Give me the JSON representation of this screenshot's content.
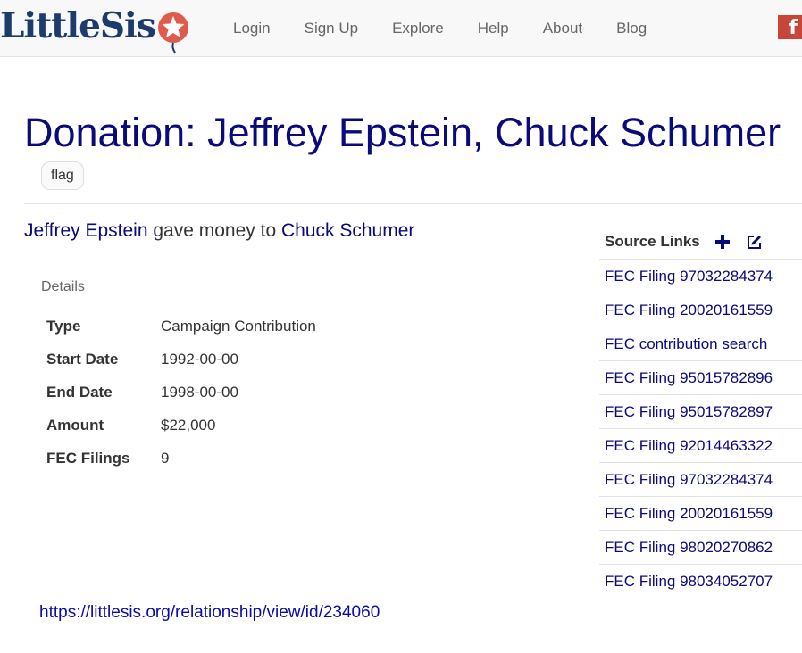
{
  "navbar": {
    "logo_text": "LittleSis",
    "links": [
      "Login",
      "Sign Up",
      "Explore",
      "Help",
      "About",
      "Blog"
    ],
    "facebook_glyph": "f",
    "brand_color": "#1d3c6b",
    "accent_color": "#e05a4d"
  },
  "page": {
    "title": "Donation: Jeffrey Epstein, Chuck Schumer",
    "flag_label": "flag",
    "description": {
      "entity1": "Jeffrey Epstein",
      "verb": "gave money to",
      "entity2": "Chuck Schumer"
    }
  },
  "details": {
    "heading": "Details",
    "rows": [
      {
        "key": "Type",
        "value": "Campaign Contribution"
      },
      {
        "key": "Start Date",
        "value": "1992-00-00"
      },
      {
        "key": "End Date",
        "value": "1998-00-00"
      },
      {
        "key": "Amount",
        "value": "$22,000"
      },
      {
        "key": "FEC Filings",
        "value": "9"
      }
    ]
  },
  "source_links": {
    "title": "Source Links",
    "add_icon": "plus-icon",
    "edit_icon": "edit-icon",
    "items": [
      "FEC Filing 97032284374",
      "FEC Filing 20020161559",
      "FEC contribution search",
      "FEC Filing 95015782896",
      "FEC Filing 95015782897",
      "FEC Filing 92014463322",
      "FEC Filing 97032284374",
      "FEC Filing 20020161559",
      "FEC Filing 98020270862",
      "FEC Filing 98034052707"
    ]
  },
  "footer": {
    "url": "https://littlesis.org/relationship/view/id/234060"
  },
  "colors": {
    "title": "#0a0a7a",
    "link": "#0a0a7a",
    "url": "#0a0aa8",
    "facebook": "#c8453a"
  }
}
